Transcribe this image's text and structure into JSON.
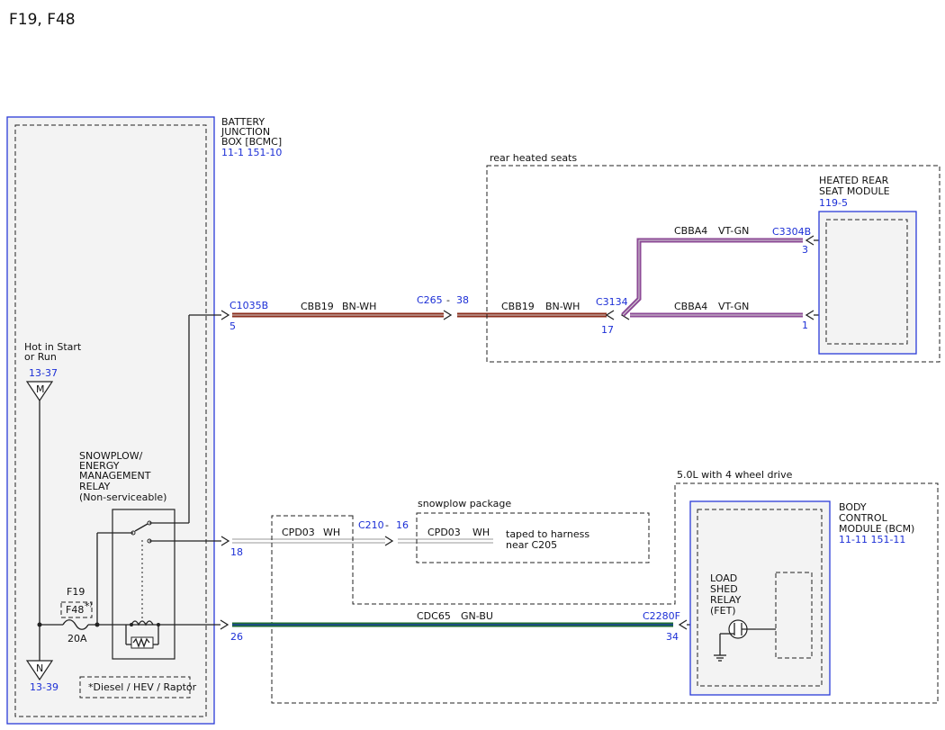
{
  "title": "F19, F48",
  "bjb": {
    "label": [
      "BATTERY",
      "JUNCTION",
      "BOX [BCMC]"
    ],
    "ref": "11-1   151-10"
  },
  "hot_label": [
    "Hot in Start",
    "or Run"
  ],
  "hot_ref": "13-37",
  "ground_ref": "13-39",
  "term_m": "M",
  "term_n": "N",
  "relay_label": [
    "SNOWPLOW/",
    "ENERGY",
    "MANAGEMENT",
    "RELAY",
    "(Non-serviceable)"
  ],
  "fuse": {
    "name": "F19",
    "alt": "F48",
    "alt_mark": "*⁾",
    "rating": "20A"
  },
  "footnote": "*Diesel / HEV / Raptor",
  "rear_seats": {
    "label": "rear heated seats",
    "module": [
      "HEATED REAR",
      "SEAT MODULE"
    ],
    "module_ref": "119-5"
  },
  "snowplow": {
    "label": "snowplow package",
    "note": [
      "taped to harness",
      "near C205"
    ]
  },
  "bcm_group": {
    "label": "5.0L with 4 wheel drive",
    "module": [
      "BODY",
      "CONTROL",
      "MODULE (BCM)"
    ],
    "module_ref": "11-11   151-11",
    "fet": [
      "LOAD",
      "SHED",
      "RELAY",
      "(FET)"
    ]
  },
  "wires": {
    "w1": {
      "connector": "C1035B",
      "pin": "5",
      "circuit": "CBB19",
      "color": "BN-WH"
    },
    "w1b": {
      "connector": "C265",
      "sep": "-",
      "pin": "38",
      "circuit": "CBB19",
      "color": "BN-WH"
    },
    "w1c": {
      "connector": "C3134",
      "pin": "17",
      "circuit": "CBBA4",
      "color": "VT-GN",
      "end_pin": "1"
    },
    "w1d": {
      "connector": "C3304B",
      "pin": "3",
      "circuit": "CBBA4",
      "color": "VT-GN"
    },
    "w2": {
      "pin": "18",
      "circuit": "CPD03",
      "color": "WH"
    },
    "w2b": {
      "connector": "C210",
      "sep": "-",
      "pin": "16",
      "circuit": "CPD03",
      "color": "WH"
    },
    "w3": {
      "pin": "26",
      "circuit": "CDC65",
      "color": "GN-BU",
      "connector": "C2280F",
      "end_pin": "34"
    }
  },
  "wire_colors": {
    "brown": "#8b2e1c",
    "white": "#d8d8d8",
    "violet": "#8c4a96",
    "green": "#1d6b32",
    "blue": "#1c2fd6"
  }
}
